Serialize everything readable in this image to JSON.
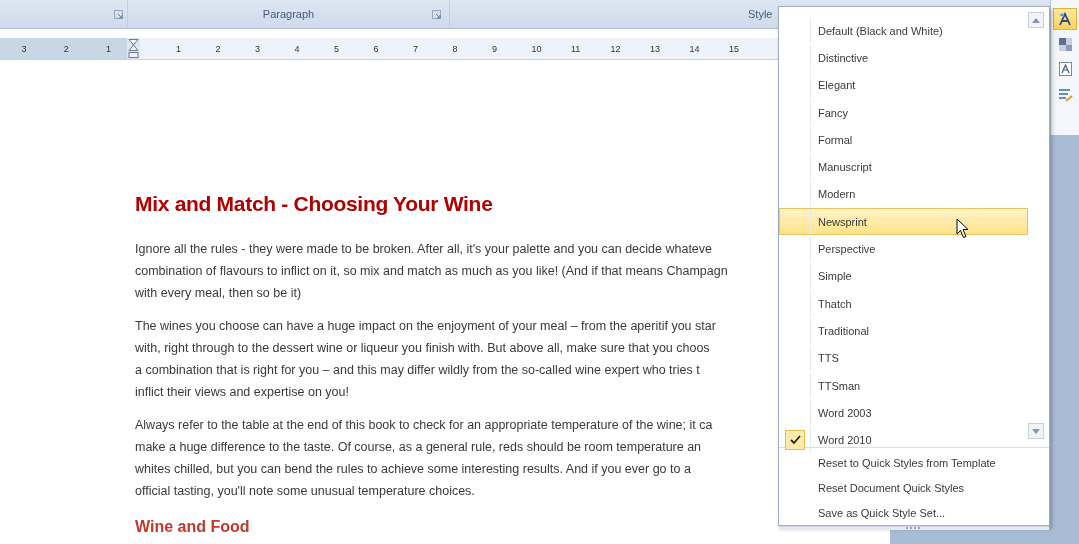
{
  "ribbon": {
    "groups": [
      {
        "launcher": true
      },
      {
        "label": "Paragraph",
        "launcher": true
      },
      {
        "label": "Style",
        "launcher": false
      }
    ],
    "side_tools": [
      {
        "kind": "style-set",
        "active": true
      },
      {
        "kind": "colors",
        "active": false
      },
      {
        "kind": "fonts",
        "active": false
      },
      {
        "kind": "spacing",
        "active": false
      }
    ]
  },
  "ruler": {
    "labels_before": [
      "3",
      "2",
      "1"
    ],
    "labels_after": [
      "1",
      "2",
      "3",
      "4",
      "5",
      "6",
      "7",
      "8",
      "9",
      "10",
      "11",
      "12",
      "13",
      "14",
      "15"
    ]
  },
  "document": {
    "heading": "Mix and Match - Choosing Your Wine",
    "paragraphs": [
      {
        "lines": [
          "Ignore all the rules - they were made to be broken.  After all, it's your palette and you can decide whateve",
          "combination of flavours to inflict on it, so mix and match as much as you like! (And if that means Champagn",
          "with every meal, then so be it)"
        ]
      },
      {
        "lines": [
          "The wines you choose can have a huge impact on the enjoyment of your meal – from the aperitif you star",
          "with, right through to the dessert wine or liqueur you finish with.  But above all, make sure that you choos",
          "a combination that is right for you – and this may differ wildly from the so-called wine expert who tries t",
          "inflict their views and expertise on you!"
        ]
      },
      {
        "lines": [
          "Always refer to the table at the end of this book to check for an appropriate temperature of the wine; it ca",
          "make a huge difference to the taste.  Of course, as a general rule, reds should be room temperature an",
          "whites chilled, but you can bend the rules to achieve some interesting results.  And if you ever go to a",
          "official tasting, you'll note some unusual temperature choices."
        ]
      }
    ],
    "subheading": "Wine and Food"
  },
  "style_menu": {
    "items": [
      {
        "label": "Default (Black and White)",
        "checked": false,
        "highlighted": false
      },
      {
        "label": "Distinctive",
        "checked": false,
        "highlighted": false
      },
      {
        "label": "Elegant",
        "checked": false,
        "highlighted": false
      },
      {
        "label": "Fancy",
        "checked": false,
        "highlighted": false
      },
      {
        "label": "Formal",
        "checked": false,
        "highlighted": false
      },
      {
        "label": "Manuscript",
        "checked": false,
        "highlighted": false
      },
      {
        "label": "Modern",
        "checked": false,
        "highlighted": false
      },
      {
        "label": "Newsprint",
        "checked": false,
        "highlighted": true
      },
      {
        "label": "Perspective",
        "checked": false,
        "highlighted": false
      },
      {
        "label": "Simple",
        "checked": false,
        "highlighted": false
      },
      {
        "label": "Thatch",
        "checked": false,
        "highlighted": false
      },
      {
        "label": "Traditional",
        "checked": false,
        "highlighted": false
      },
      {
        "label": "TTS",
        "checked": false,
        "highlighted": false
      },
      {
        "label": "TTSman",
        "checked": false,
        "highlighted": false
      },
      {
        "label": "Word 2003",
        "checked": false,
        "highlighted": false
      },
      {
        "label": "Word 2010",
        "checked": true,
        "highlighted": false
      }
    ],
    "commands": [
      "Reset to Quick Styles from Template",
      "Reset Document Quick Styles",
      "Save as Quick Style Set..."
    ]
  }
}
